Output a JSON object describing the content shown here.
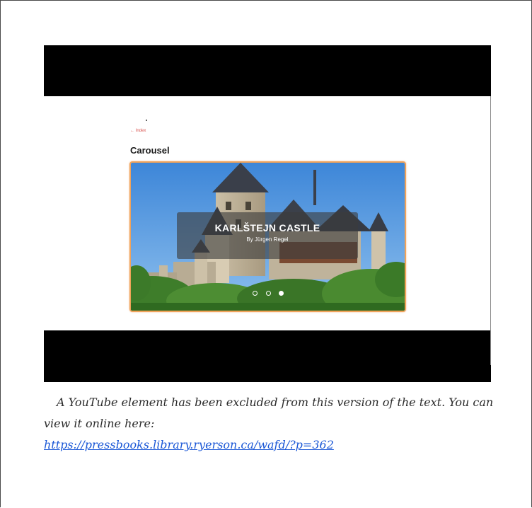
{
  "video": {
    "back_link": "← Index",
    "page_title": "Carousel",
    "carousel": {
      "caption_title": "KARLŠTEJN CASTLE",
      "caption_subtitle": "By Jürgen Regel",
      "slide_count": 3,
      "active_slide": 3,
      "border_color": "#f0a35a"
    }
  },
  "notice": {
    "text": "A YouTube element has been excluded from this version of the text. You can view it online here:",
    "link_text": "https://pressbooks.library.ryerson.ca/wafd/?p=362",
    "link_color": "#1a57d6"
  }
}
